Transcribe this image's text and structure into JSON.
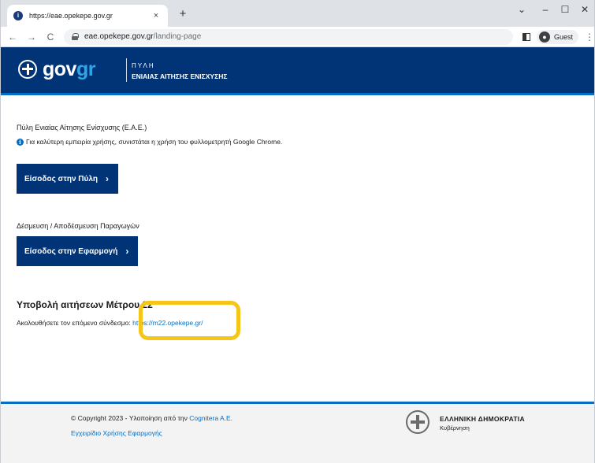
{
  "browser": {
    "tab_title": "https://eae.opekepe.gov.gr",
    "tab_close": "×",
    "new_tab": "+",
    "window_controls": {
      "chevron": "⌄",
      "minimize": "–",
      "maximize": "☐",
      "close": "✕"
    },
    "nav": {
      "back": "←",
      "forward": "→",
      "reload": "C"
    },
    "url_host": "eae.opekepe.gov.gr",
    "url_path": "/landing-page",
    "profile_name": "Guest",
    "menu": "⋮"
  },
  "header": {
    "logo_gov": "gov",
    "logo_gr": "gr",
    "portal_label": "ΠΥΛΗ",
    "portal_title": "ΕΝΙΑΙΑΣ ΑΙΤΗΣΗΣ ΕΝΙΣΧΥΣΗΣ"
  },
  "main": {
    "section1_title": "Πύλη Ενιαίας Αίτησης Ενίσχυσης (Ε.Α.Ε.)",
    "info_text": "Για καλύτερη εμπειρία χρήσης, συνιστάται η χρήση του φυλλομετρητή Google Chrome.",
    "portal_button": "Είσοδος στην Πύλη",
    "section2_title": "Δέσμευση / Αποδέσμευση Παραγωγών",
    "app_button": "Είσοδος στην Εφαρμογή",
    "m22_heading": "Υποβολή αιτήσεων Μέτρου 22",
    "m22_text": "Ακολουθήσετε τον επόμενο σύνδεσμο:",
    "m22_link": "https://m22.opekepe.gr/",
    "chevron": "›"
  },
  "footer": {
    "copyright_prefix": "© Copyright 2023 - Υλοποίηση από την",
    "copyright_company": "Cognitera A.E.",
    "manual_link": "Εγχειρίδιο Χρήσης Εφαρμογής",
    "gov_name": "ΕΛΛΗΝΙΚΗ ΔΗΜΟΚΡΑΤΙΑ",
    "gov_sub": "Κυβέρνηση"
  },
  "colors": {
    "brand_blue": "#003476",
    "accent_blue": "#046ec5",
    "highlight": "#f5c518"
  }
}
